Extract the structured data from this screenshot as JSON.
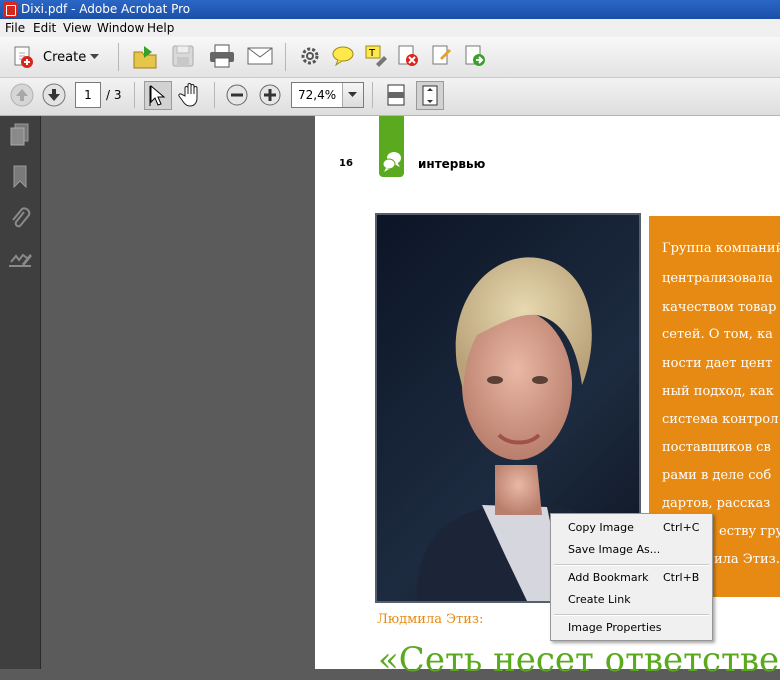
{
  "window": {
    "title": "Dixi.pdf - Adobe Acrobat Pro"
  },
  "menu": [
    "File",
    "Edit",
    "View",
    "Window",
    "Help"
  ],
  "toolbar": {
    "create_label": "Create"
  },
  "nav": {
    "page_value": "1",
    "page_total": "/ 3",
    "zoom_value": "72,4%"
  },
  "document": {
    "page_number": "16",
    "section": "интервью",
    "caption": "Людмила Этиз:",
    "headline": "«Сеть несет ответствен",
    "sidebar_text_lines": [
      "Группа компаний",
      "централизовала",
      "качеством товар",
      "сетей. О том, ка",
      "ности дает цент",
      "ный подход, как",
      "система контрол",
      "поставщиков св",
      "рами в деле соб",
      "дартов, рассказ",
      "еству гру",
      "ила Этиз."
    ],
    "colors": {
      "accent_green": "#5aa91f",
      "accent_orange": "#e78a13",
      "caption_orange": "#e78a13"
    }
  },
  "context_menu": {
    "items": [
      {
        "label": "Copy Image",
        "shortcut": "Ctrl+C"
      },
      {
        "label": "Save Image As...",
        "shortcut": ""
      },
      {
        "label": "Add Bookmark",
        "shortcut": "Ctrl+B"
      },
      {
        "label": "Create Link",
        "shortcut": ""
      },
      {
        "label": "Image Properties",
        "shortcut": ""
      }
    ]
  }
}
